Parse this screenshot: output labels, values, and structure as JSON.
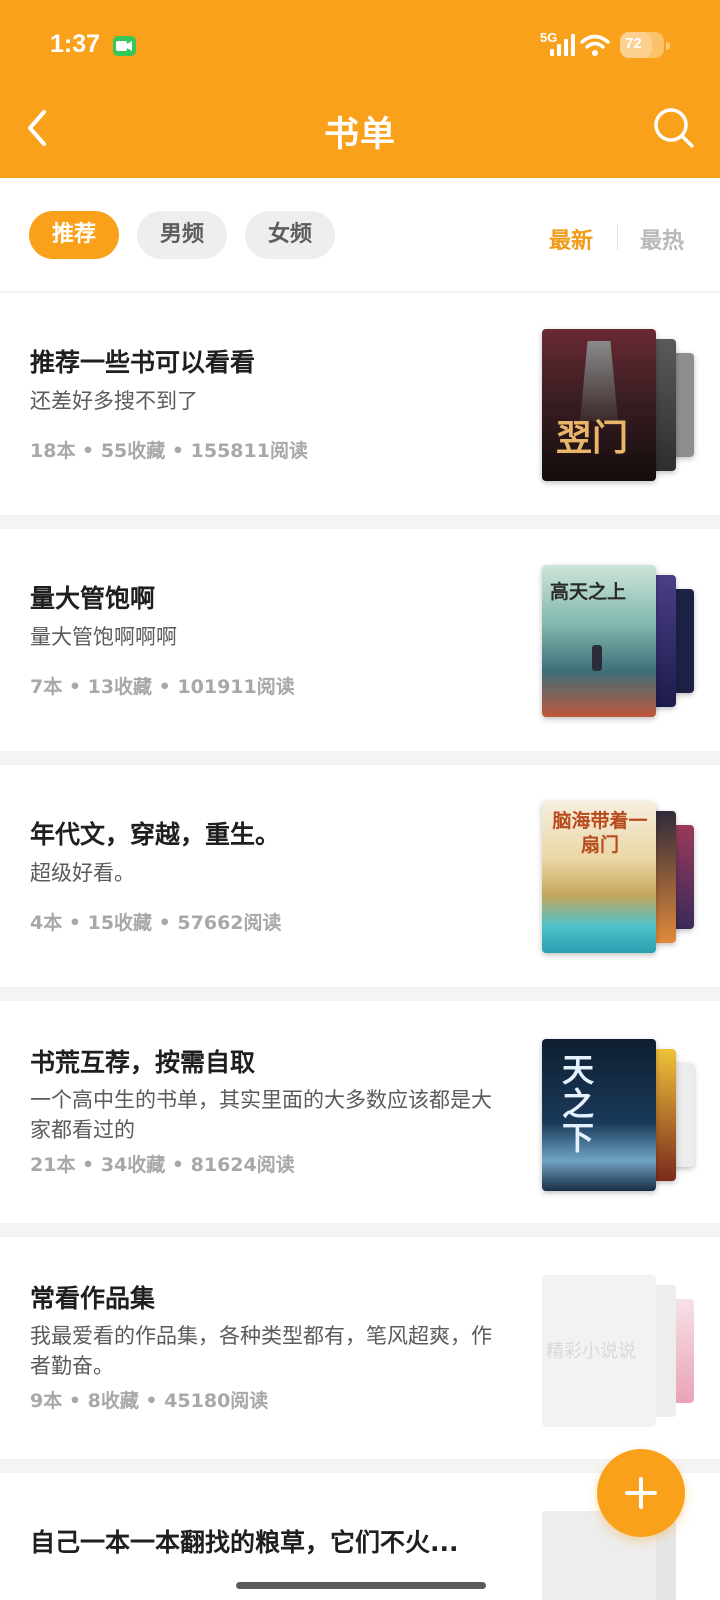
{
  "status": {
    "time": "1:37",
    "network": "5G",
    "battery": "72",
    "battery_level": 0.72
  },
  "header": {
    "title": "书单",
    "back_icon": "chevron-left-icon",
    "search_icon": "search-icon"
  },
  "filters": {
    "chips": [
      {
        "label": "推荐",
        "active": true
      },
      {
        "label": "男频",
        "active": false
      },
      {
        "label": "女频",
        "active": false
      }
    ],
    "sort": [
      {
        "label": "最新",
        "active": true
      },
      {
        "label": "最热",
        "active": false
      }
    ]
  },
  "booklists": [
    {
      "title": "推荐一些书可以看看",
      "desc": "还差好多搜不到了",
      "meta": "18本 • 55收藏 • 155811阅读",
      "cover_text": "翌门",
      "colors": {
        "front": "#3a1e22",
        "back1": "#4a4a4a",
        "back2": "#8e8e8e"
      }
    },
    {
      "title": "量大管饱啊",
      "desc": "量大管饱啊啊啊",
      "meta": "7本 • 13收藏 • 101911阅读",
      "cover_text": "高天之上",
      "colors": {
        "front": "#6fb0a8",
        "back1": "#2c2a6a",
        "back2": "#1d2145"
      }
    },
    {
      "title": "年代文，穿越，重生。",
      "desc": "超级好看。",
      "meta": "4本 • 15收藏 • 57662阅读",
      "cover_text": "脑海带着一扇门",
      "colors": {
        "front": "#e9c98c",
        "back1": "#3a2a3c",
        "back2": "#7a2a4a"
      }
    },
    {
      "title": "书荒互荐，按需自取",
      "desc": "一个高中生的书单，其实里面的大多数应该都是大家都看过的",
      "meta": "21本 • 34收藏 • 81624阅读",
      "cover_text": "天之下",
      "colors": {
        "front": "#14283c",
        "back1": "#e2b12a",
        "back2": "#e9e9e9"
      }
    },
    {
      "title": "常看作品集",
      "desc": "我最爱看的作品集，各种类型都有，笔风超爽，作者勤奋。",
      "meta": "9本 • 8收藏 • 45180阅读",
      "cover_text": "精彩小说说",
      "colors": {
        "front": "#f1f1f1",
        "back1": "#eaeaea",
        "back2": "#f3d8dc"
      }
    },
    {
      "title": "自己一本一本翻找的粮草，它们不火...",
      "desc": "",
      "meta": "",
      "cover_text": "",
      "colors": {
        "front": "#ededed",
        "back1": "#e6e6e6",
        "back2": "#e0e0e0"
      }
    }
  ],
  "fab": {
    "icon": "plus-icon"
  }
}
